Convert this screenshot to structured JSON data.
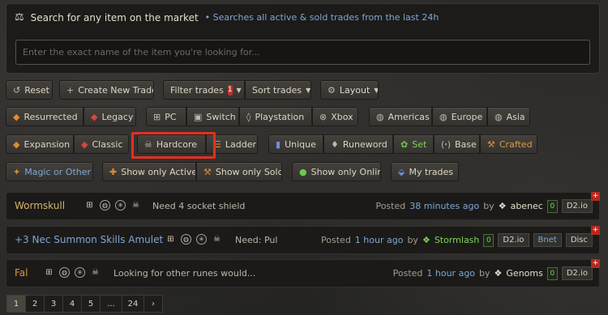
{
  "search": {
    "title": "Search for any item on the market",
    "subtitle": "• Searches all active & sold trades from the last 24h",
    "placeholder": "Enter the exact name of the item you're looking for..."
  },
  "toolbar": {
    "reset": "Reset",
    "create": "Create New Trade",
    "filter": "Filter trades",
    "filter_count": "1",
    "sort": "Sort trades",
    "layout": "Layout"
  },
  "filters": {
    "resurrected": "Resurrected",
    "legacy": "Legacy",
    "pc": "PC",
    "switch": "Switch",
    "playstation": "Playstation",
    "xbox": "Xbox",
    "americas": "Americas",
    "europe": "Europe",
    "asia": "Asia",
    "expansion": "Expansion",
    "classic": "Classic",
    "hardcore": "Hardcore",
    "ladder": "Ladder",
    "unique": "Unique",
    "runeword": "Runeword",
    "set": "Set",
    "base": "Base",
    "crafted": "Crafted",
    "magic": "Magic or Other",
    "active": "Show only Active",
    "sold": "Show only Sold",
    "online": "Show only Online",
    "mytrades": "My trades"
  },
  "trades": [
    {
      "title": "Wormskull",
      "message": "Need 4 socket shield",
      "posted": "Posted",
      "ago": "38 minutes ago",
      "by": "by",
      "user": "abenec",
      "count": "0",
      "tags": [
        "D2.io"
      ]
    },
    {
      "title": "+3 Nec Summon Skills Amulet",
      "message": "Need: Pul",
      "posted": "Posted",
      "ago": "1 hour ago",
      "by": "by",
      "user": "Stormlash",
      "count": "0",
      "tags": [
        "D2.io",
        "Bnet",
        "Disc"
      ]
    },
    {
      "title": "Fal",
      "message": "Looking for other runes would...",
      "posted": "Posted",
      "ago": "1 hour ago",
      "by": "by",
      "user": "Genoms",
      "count": "0",
      "tags": [
        "D2.io"
      ]
    }
  ],
  "pagination": [
    "1",
    "2",
    "3",
    "4",
    "5",
    "...",
    "24",
    "›"
  ],
  "colors": {
    "accent_blue": "#7fa6d4",
    "online_green": "#7fd45a",
    "highlight_red": "#e2301f"
  }
}
